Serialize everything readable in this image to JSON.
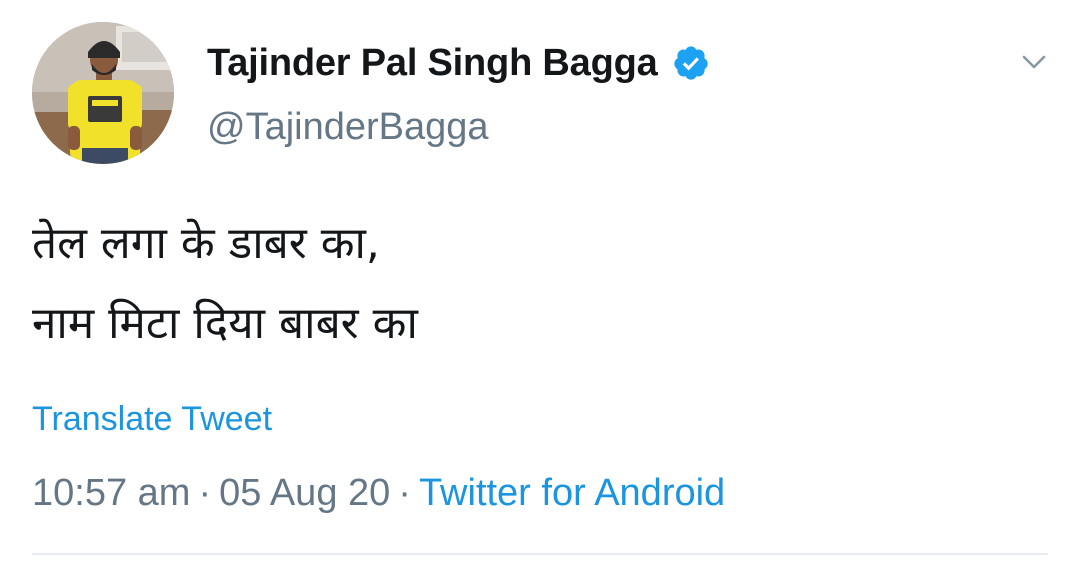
{
  "user": {
    "display_name": "Tajinder Pal Singh Bagga",
    "handle": "@TajinderBagga",
    "avatar_icon": "profile-photo",
    "verified_icon": "verified-badge-icon",
    "verified_color": "#1da1f2"
  },
  "tweet": {
    "lines": [
      "तेल लगा के डाबर का,",
      "नाम मिटा दिया बाबर का"
    ],
    "translate_label": "Translate Tweet"
  },
  "meta": {
    "time": "10:57 am",
    "separator": "·",
    "date": "05 Aug 20",
    "source": "Twitter for Android"
  },
  "menu": {
    "icon": "chevron-down-icon"
  },
  "colors": {
    "text": "#14171a",
    "secondary": "#657786",
    "link": "#1b95e0",
    "divider": "#e6ecf0"
  }
}
